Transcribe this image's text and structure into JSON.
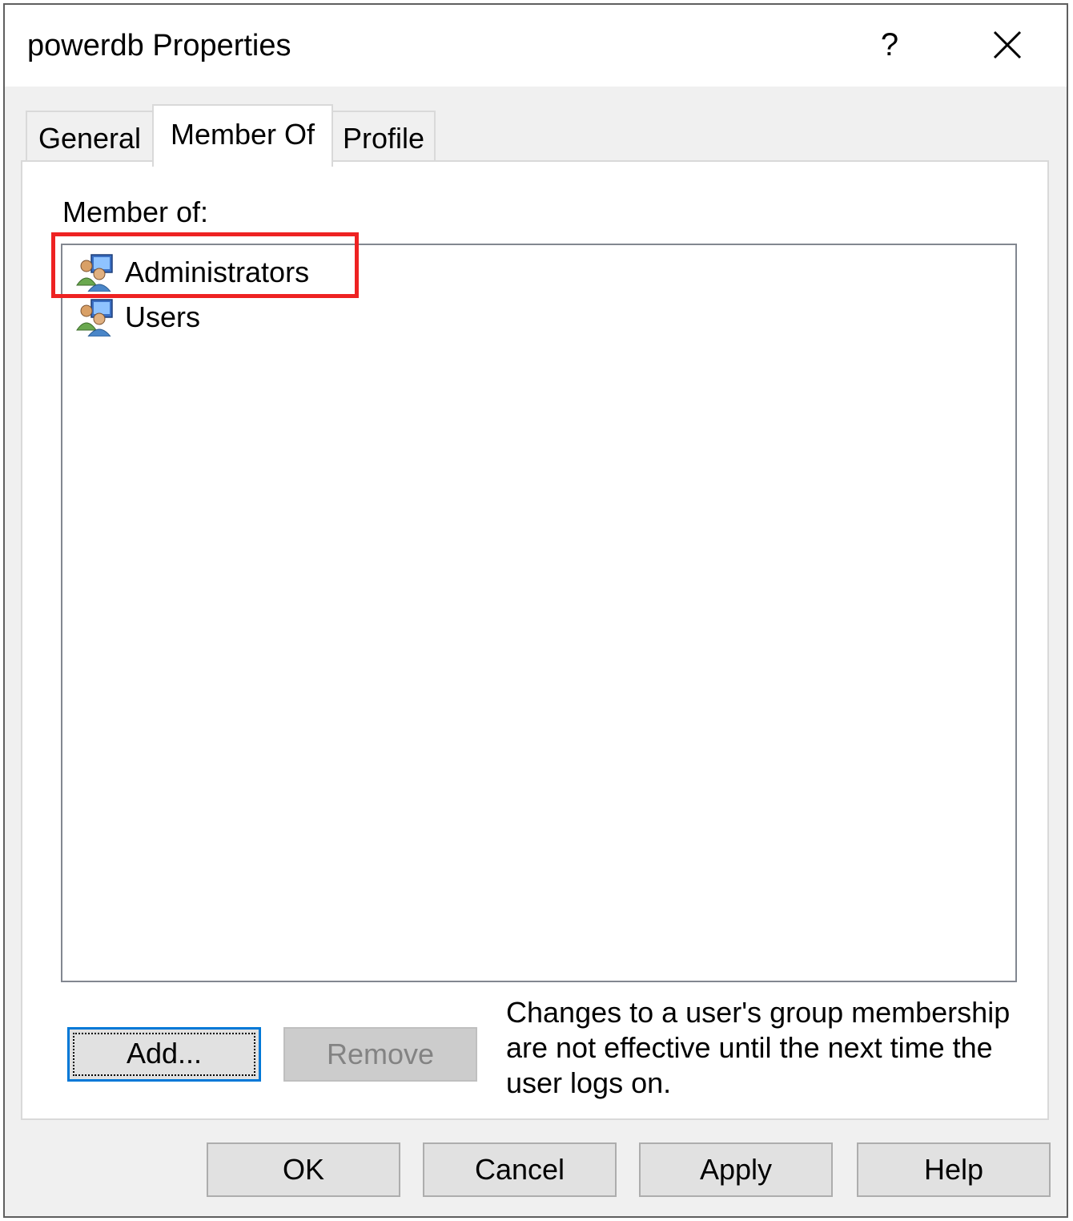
{
  "window": {
    "title": "powerdb Properties",
    "help_glyph": "?",
    "close_icon": "close-icon"
  },
  "tabs": [
    {
      "label": "General",
      "active": false
    },
    {
      "label": "Member Of",
      "active": true
    },
    {
      "label": "Profile",
      "active": false
    }
  ],
  "member_of": {
    "label": "Member of:",
    "items": [
      {
        "name": "Administrators",
        "icon": "group-icon",
        "highlighted": true
      },
      {
        "name": "Users",
        "icon": "group-icon",
        "highlighted": false
      }
    ]
  },
  "actions": {
    "add_label": "Add...",
    "remove_label": "Remove",
    "note": "Changes to a user's group membership are not effective until the next time the user logs on."
  },
  "footer": {
    "ok_label": "OK",
    "cancel_label": "Cancel",
    "apply_label": "Apply",
    "help_label": "Help"
  },
  "colors": {
    "highlight": "#ee2222",
    "focus_border": "#0078d7"
  }
}
